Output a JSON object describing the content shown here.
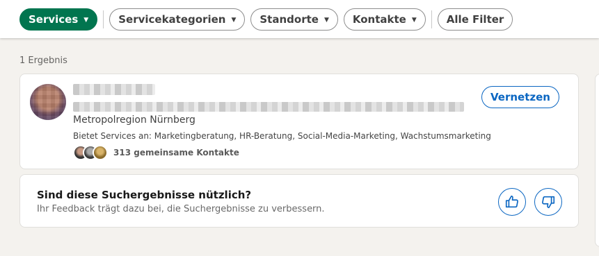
{
  "filters": {
    "services": "Services",
    "service_categories": "Servicekategorien",
    "locations": "Standorte",
    "contacts": "Kontakte",
    "all_filters": "Alle Filter"
  },
  "results": {
    "count_label": "1 Ergebnis"
  },
  "result_card": {
    "location": "Metropolregion Nürnberg",
    "services_offered": "Bietet Services an: Marketingberatung, HR-Beratung, Social-Media-Marketing, Wachstumsmarketing",
    "mutual_contacts": "313 gemeinsame Kontakte",
    "connect_label": "Vernetzen"
  },
  "feedback": {
    "title": "Sind diese Suchergebnisse nützlich?",
    "subtitle": "Ihr Feedback trägt dazu bei, die Suchergebnisse zu verbessern."
  },
  "icons": {
    "caret": "caret-down-icon",
    "thumbs_up": "thumbs-up-icon",
    "thumbs_down": "thumbs-down-icon"
  },
  "colors": {
    "active_filter": "#01754f",
    "link_blue": "#0a66c2",
    "page_bg": "#f4f2ee"
  }
}
